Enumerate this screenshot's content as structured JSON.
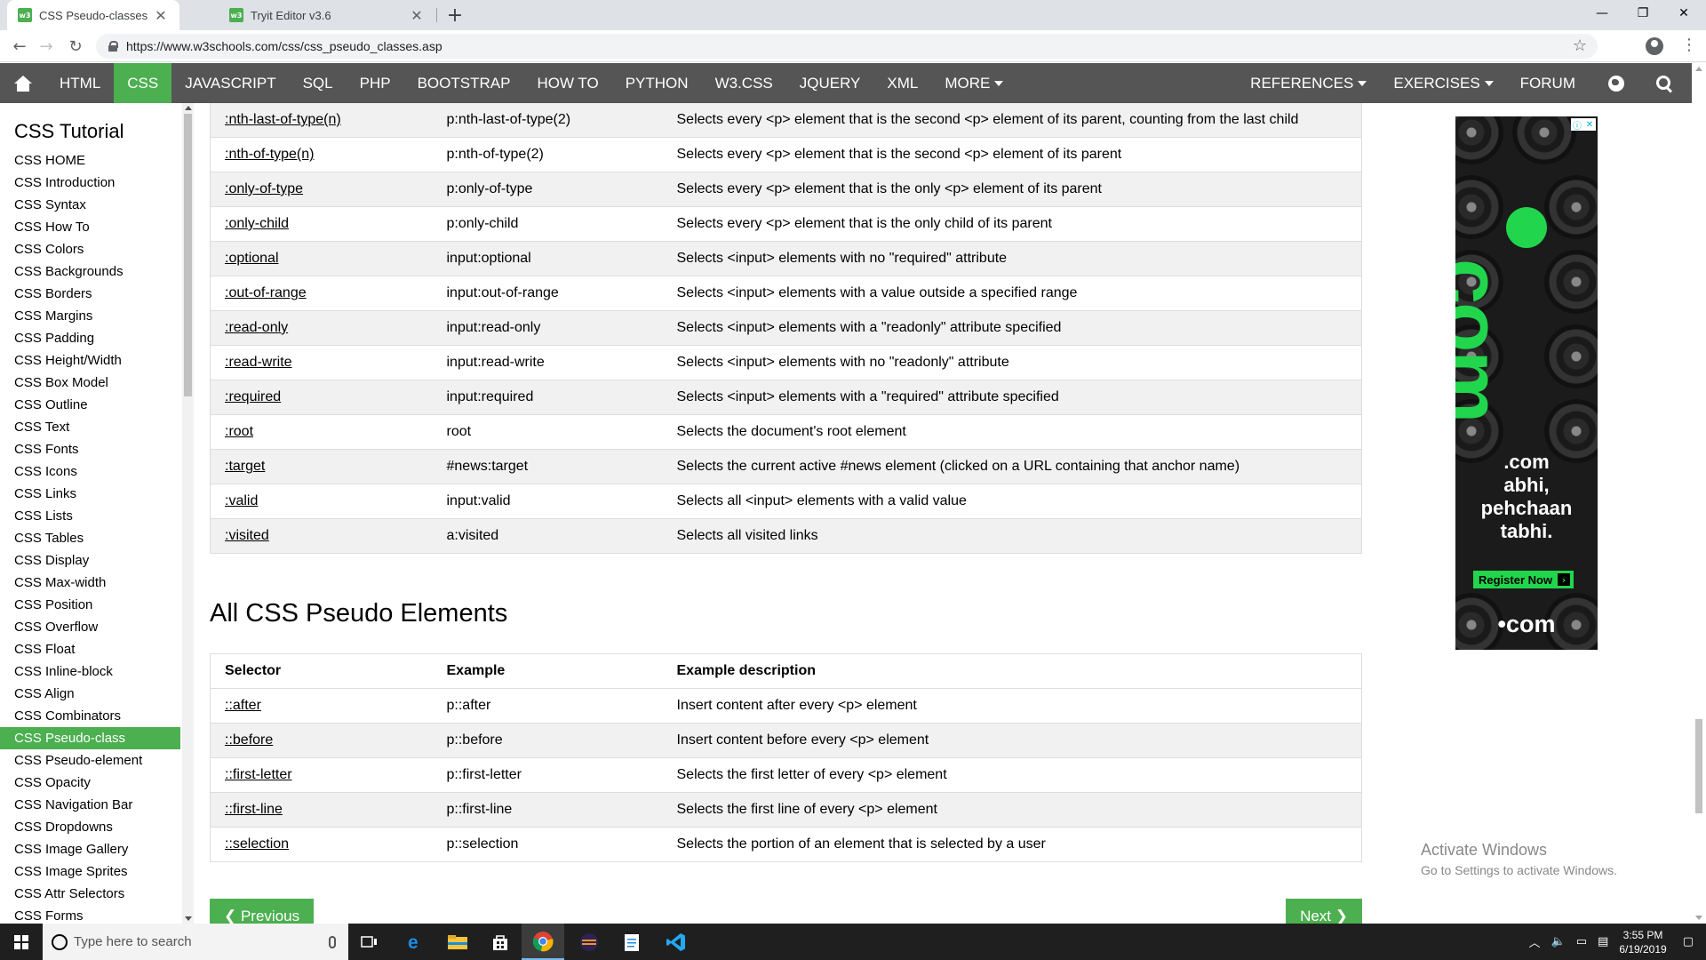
{
  "browser": {
    "tabs": [
      {
        "title": "CSS Pseudo-classes",
        "favicon": "w3"
      },
      {
        "title": "Tryit Editor v3.6",
        "favicon": "w3"
      }
    ],
    "url": "https://www.w3schools.com/css/css_pseudo_classes.asp"
  },
  "topnav": {
    "items": [
      "HTML",
      "CSS",
      "JAVASCRIPT",
      "SQL",
      "PHP",
      "BOOTSTRAP",
      "HOW TO",
      "PYTHON",
      "W3.CSS",
      "JQUERY",
      "XML",
      "MORE"
    ],
    "active": "CSS",
    "right": [
      "REFERENCES",
      "EXERCISES",
      "FORUM"
    ]
  },
  "sidebar": {
    "title": "CSS Tutorial",
    "items": [
      "CSS HOME",
      "CSS Introduction",
      "CSS Syntax",
      "CSS How To",
      "CSS Colors",
      "CSS Backgrounds",
      "CSS Borders",
      "CSS Margins",
      "CSS Padding",
      "CSS Height/Width",
      "CSS Box Model",
      "CSS Outline",
      "CSS Text",
      "CSS Fonts",
      "CSS Icons",
      "CSS Links",
      "CSS Lists",
      "CSS Tables",
      "CSS Display",
      "CSS Max-width",
      "CSS Position",
      "CSS Overflow",
      "CSS Float",
      "CSS Inline-block",
      "CSS Align",
      "CSS Combinators",
      "CSS Pseudo-class",
      "CSS Pseudo-element",
      "CSS Opacity",
      "CSS Navigation Bar",
      "CSS Dropdowns",
      "CSS Image Gallery",
      "CSS Image Sprites",
      "CSS Attr Selectors",
      "CSS Forms"
    ],
    "active": "CSS Pseudo-class"
  },
  "pseudo_classes": {
    "rows": [
      {
        "selector": ":nth-last-of-type(n)",
        "example": "p:nth-last-of-type(2)",
        "description": "Selects every <p> element that is the second <p> element of its parent, counting from the last child"
      },
      {
        "selector": ":nth-of-type(n)",
        "example": "p:nth-of-type(2)",
        "description": "Selects every <p> element that is the second <p> element of its parent"
      },
      {
        "selector": ":only-of-type",
        "example": "p:only-of-type",
        "description": "Selects every <p> element that is the only <p> element of its parent"
      },
      {
        "selector": ":only-child",
        "example": "p:only-child",
        "description": "Selects every <p> element that is the only child of its parent"
      },
      {
        "selector": ":optional",
        "example": "input:optional",
        "description": "Selects <input> elements with no \"required\" attribute"
      },
      {
        "selector": ":out-of-range",
        "example": "input:out-of-range",
        "description": "Selects <input> elements with a value outside a specified range"
      },
      {
        "selector": ":read-only",
        "example": "input:read-only",
        "description": "Selects <input> elements with a \"readonly\" attribute specified"
      },
      {
        "selector": ":read-write",
        "example": "input:read-write",
        "description": "Selects <input> elements with no \"readonly\" attribute"
      },
      {
        "selector": ":required",
        "example": "input:required",
        "description": "Selects <input> elements with a \"required\" attribute specified"
      },
      {
        "selector": ":root",
        "example": "root",
        "description": "Selects the document's root element"
      },
      {
        "selector": ":target",
        "example": "#news:target",
        "description": "Selects the current active #news element (clicked on a URL containing that anchor name)"
      },
      {
        "selector": ":valid",
        "example": "input:valid",
        "description": "Selects all <input> elements with a valid value"
      },
      {
        "selector": ":visited",
        "example": "a:visited",
        "description": "Selects all visited links"
      }
    ]
  },
  "pseudo_elements": {
    "title": "All CSS Pseudo Elements",
    "headers": [
      "Selector",
      "Example",
      "Example description"
    ],
    "rows": [
      {
        "selector": "::after",
        "example": "p::after",
        "description": "Insert content after every <p> element"
      },
      {
        "selector": "::before",
        "example": "p::before",
        "description": "Insert content before every <p> element"
      },
      {
        "selector": "::first-letter",
        "example": "p::first-letter",
        "description": "Selects the first letter of every <p> element"
      },
      {
        "selector": "::first-line",
        "example": "p::first-line",
        "description": "Selects the first line of every <p> element"
      },
      {
        "selector": "::selection",
        "example": "p::selection",
        "description": "Selects the portion of an element that is selected by a user"
      }
    ]
  },
  "pager": {
    "previous": "Previous",
    "next": "Next"
  },
  "ad": {
    "big_text": "com",
    "tagline": [
      ".com",
      "abhi,",
      "pehchaan",
      "tabhi."
    ],
    "cta": "Register Now",
    "logo": "•com",
    "accent": "#21d64c"
  },
  "watermark": {
    "line1": "Activate Windows",
    "line2": "Go to Settings to activate Windows."
  },
  "taskbar": {
    "search_placeholder": "Type here to search",
    "time": "3:55 PM",
    "date": "6/19/2019"
  },
  "colors": {
    "accent": "#4caf50",
    "nav": "#555555"
  }
}
